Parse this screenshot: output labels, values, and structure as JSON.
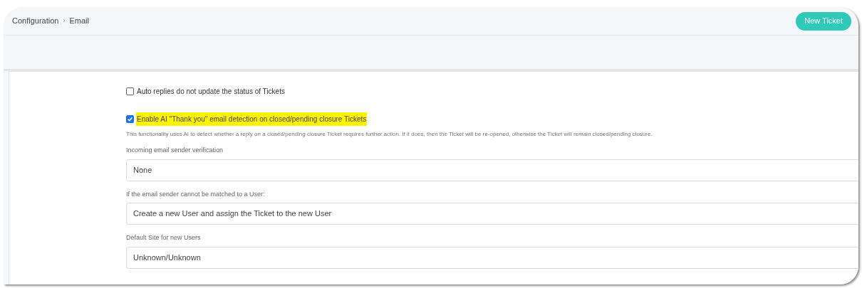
{
  "breadcrumb": [
    "Configuration",
    "›",
    "Email"
  ],
  "new_ticket_button": "New Ticket",
  "checkboxes": [
    {
      "label": "Auto replies do not update the status of Tickets",
      "checked": false,
      "highlighted": false
    },
    {
      "label": "Enable AI \"Thank you\" email detection on closed/pending closure Tickets",
      "checked": true,
      "highlighted": true,
      "description": "This functionality uses AI to detect whether a reply on a closed/pending closure Ticket requires further action. If it does, then the Ticket will be re-opened, otherwise the Ticket will remain closed/pending closure."
    }
  ],
  "fields": [
    {
      "label": "Incoming email sender verification",
      "value": "None"
    },
    {
      "label": "If the email sender cannot be matched to a User:",
      "value": "Create a new User and assign the Ticket to the new User"
    },
    {
      "label": "Default Site for new Users",
      "value": "Unknown/Unknown"
    }
  ]
}
